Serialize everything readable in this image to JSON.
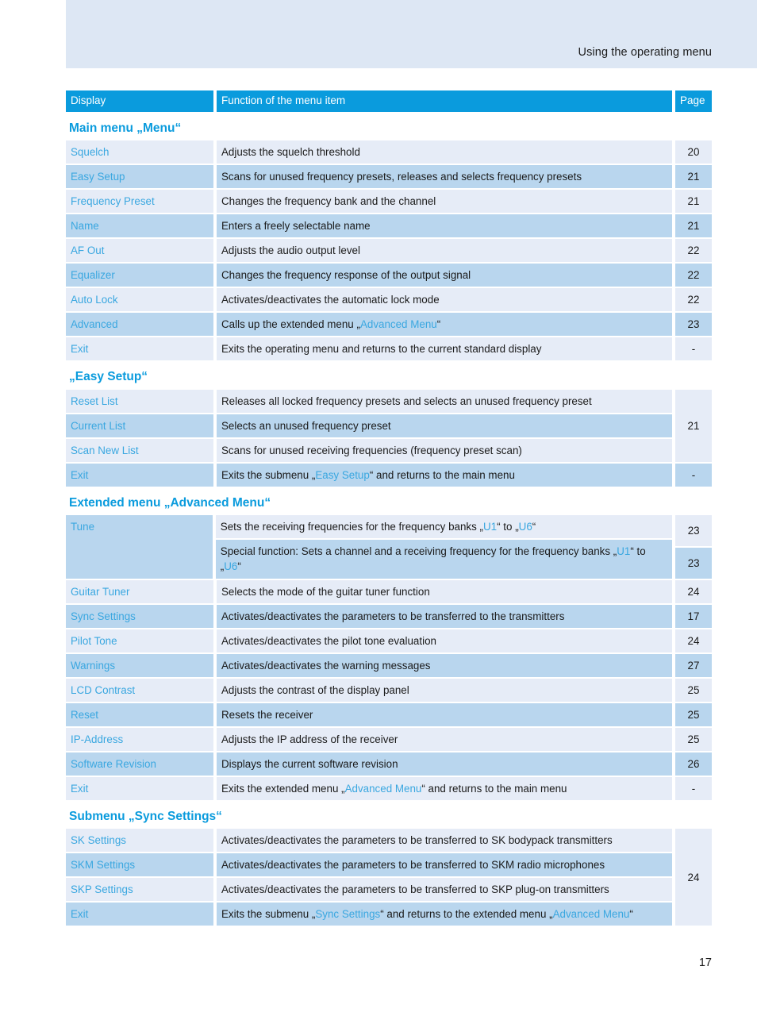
{
  "header": {
    "title": "Using the operating menu"
  },
  "footer": {
    "page_number": "17"
  },
  "table": {
    "columns": {
      "display": "Display",
      "function": "Function of the menu item",
      "page": "Page"
    }
  },
  "sections": [
    {
      "heading": "Main menu „Menu“",
      "rows": [
        {
          "display": "Squelch",
          "function": "Adjusts the squelch threshold",
          "page": "20"
        },
        {
          "display": "Easy Setup",
          "function": "Scans for unused frequency presets, releases and selects frequency presets",
          "page": "21"
        },
        {
          "display": "Frequency Preset",
          "function": "Changes the frequency bank and the channel",
          "page": "21"
        },
        {
          "display": "Name",
          "function": "Enters a freely selectable name",
          "page": "21"
        },
        {
          "display": "AF Out",
          "function": "Adjusts the audio output level",
          "page": "22"
        },
        {
          "display": "Equalizer",
          "function": "Changes the frequency response of the output signal",
          "page": "22"
        },
        {
          "display": "Auto Lock",
          "function": "Activates/deactivates the automatic lock mode",
          "page": "22"
        },
        {
          "display": "Advanced",
          "function_pre": "Calls up the extended menu „",
          "function_link": "Advanced Menu",
          "function_post": "“",
          "page": "23"
        },
        {
          "display": "Exit",
          "function": "Exits the operating menu and returns to the current standard display",
          "page": "-"
        }
      ]
    },
    {
      "heading": "„Easy Setup“",
      "rows": [
        {
          "display": "Reset List",
          "function": "Releases all locked frequency presets and selects an unused frequency preset"
        },
        {
          "display": "Current List",
          "function": "Selects an unused frequency preset"
        },
        {
          "display": "Scan New List",
          "function": "Scans for unused receiving frequencies (frequency preset scan)"
        }
      ],
      "group_page": "21",
      "trailing_row": {
        "display": "Exit",
        "function_pre": "Exits the submenu „",
        "function_link": "Easy Setup",
        "function_post": "“ and returns to the main menu",
        "page": "-"
      }
    },
    {
      "heading": "Extended menu „Advanced Menu“",
      "tune": {
        "display": "Tune",
        "sub_rows": [
          {
            "parts": [
              {
                "t": "Sets the receiving frequencies for the frequency banks „",
                "link": false
              },
              {
                "t": "U1",
                "link": true
              },
              {
                "t": "“ to „",
                "link": false
              },
              {
                "t": "U6",
                "link": true
              },
              {
                "t": "“",
                "link": false
              }
            ],
            "page": "23"
          },
          {
            "parts": [
              {
                "t": "Special function: Sets a channel and a receiving frequency for the frequency banks „",
                "link": false
              },
              {
                "t": "U1",
                "link": true
              },
              {
                "t": "“ to „",
                "link": false
              },
              {
                "t": "U6",
                "link": true
              },
              {
                "t": "“",
                "link": false
              }
            ],
            "page": "23"
          }
        ]
      },
      "rows": [
        {
          "display": "Guitar Tuner",
          "function": "Selects the mode of the guitar tuner function",
          "page": "24"
        },
        {
          "display": "Sync Settings",
          "function": "Activates/deactivates the parameters to be transferred to the transmitters",
          "page": "17"
        },
        {
          "display": "Pilot Tone",
          "function": "Activates/deactivates the pilot tone evaluation",
          "page": "24"
        },
        {
          "display": "Warnings",
          "function": "Activates/deactivates the warning messages",
          "page": "27"
        },
        {
          "display": "LCD Contrast",
          "function": "Adjusts the contrast of the display panel",
          "page": "25"
        },
        {
          "display": "Reset",
          "function": "Resets the receiver",
          "page": "25"
        },
        {
          "display": "IP-Address",
          "function": "Adjusts the IP address of the receiver",
          "page": "25"
        },
        {
          "display": "Software Revision",
          "function": "Displays the current software revision",
          "page": "26"
        },
        {
          "display": "Exit",
          "function_pre": "Exits the extended menu „",
          "function_link": "Advanced Menu",
          "function_post": "“ and returns to the main menu",
          "page": "-"
        }
      ]
    },
    {
      "heading": "Submenu „Sync Settings“",
      "group_page": "24",
      "rows": [
        {
          "display": "SK Settings",
          "function": "Activates/deactivates the parameters to be transferred to SK bodypack transmitters"
        },
        {
          "display": "SKM Settings",
          "function": "Activates/deactivates the parameters to be transferred to SKM radio microphones"
        },
        {
          "display": "SKP Settings",
          "function": "Activates/deactivates the parameters to be transferred to SKP plug-on transmitters"
        },
        {
          "display": "Exit",
          "parts": [
            {
              "t": "Exits the submenu „",
              "link": false
            },
            {
              "t": "Sync Settings",
              "link": true
            },
            {
              "t": "“ and returns to the extended menu „",
              "link": false
            },
            {
              "t": "Advanced Menu",
              "link": true
            },
            {
              "t": "“",
              "link": false
            }
          ]
        }
      ]
    }
  ],
  "colors": {
    "accent": "#0a9bdd",
    "link": "#3aa7e0",
    "row_light": "#e6ecf7",
    "row_blue": "#b9d6ee",
    "header_band": "#dde7f4"
  }
}
